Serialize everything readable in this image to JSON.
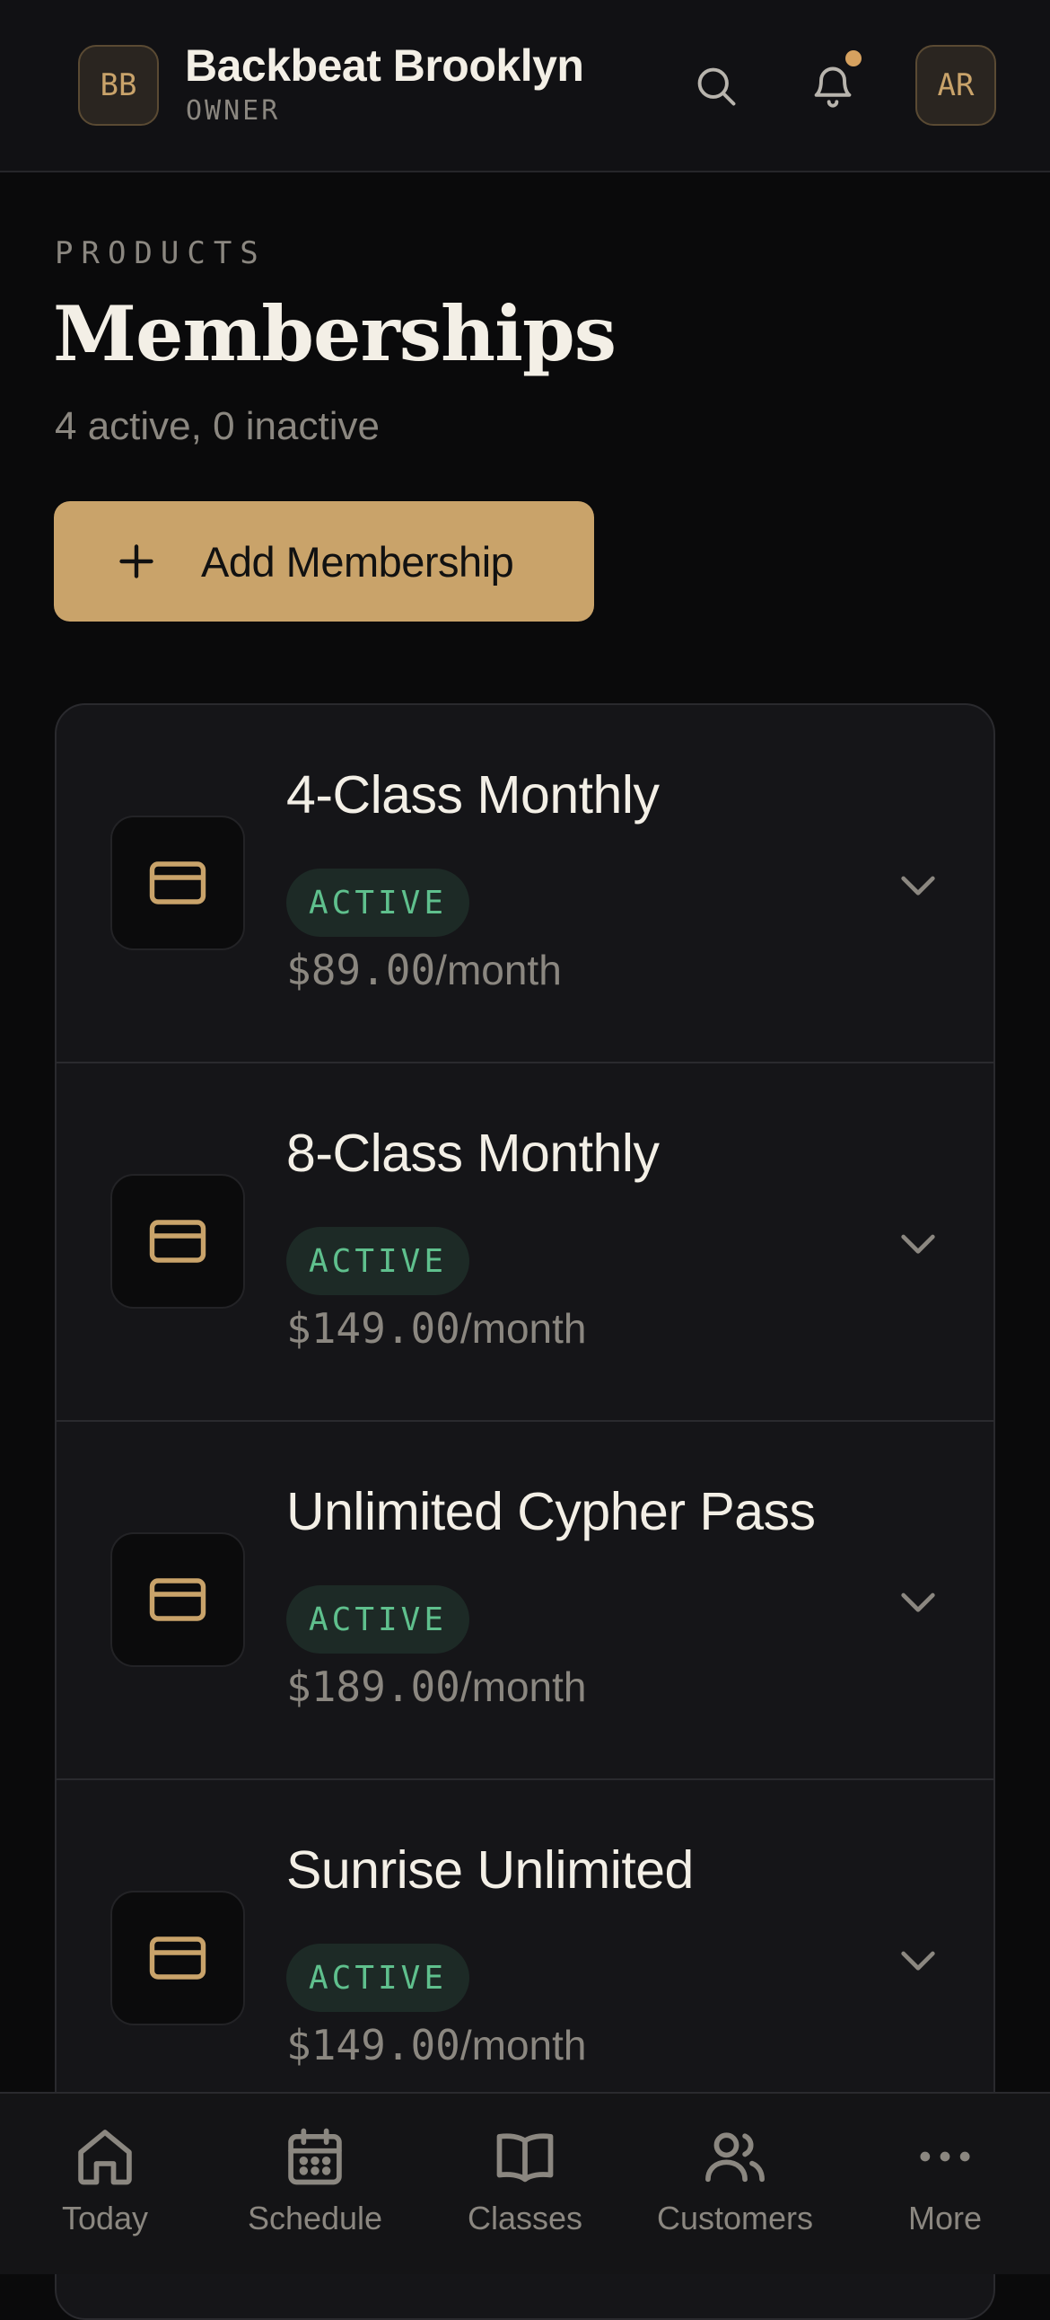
{
  "header": {
    "org_initials": "BB",
    "org_name": "Backbeat Brooklyn",
    "role": "OWNER",
    "user_initials": "AR",
    "icons": [
      "search-icon",
      "bell-icon"
    ],
    "has_notification": true
  },
  "page": {
    "eyebrow": "PRODUCTS",
    "title": "Memberships",
    "subtitle": "4 active, 0 inactive",
    "add_button_label": "Add Membership"
  },
  "memberships": [
    {
      "name": "4-Class Monthly",
      "status": "ACTIVE",
      "price": "$89.00",
      "period": "/month",
      "icon": "credit-card-icon"
    },
    {
      "name": "8-Class Monthly",
      "status": "ACTIVE",
      "price": "$149.00",
      "period": "/month",
      "icon": "credit-card-icon"
    },
    {
      "name": "Unlimited Cypher Pass",
      "status": "ACTIVE",
      "price": "$189.00",
      "period": "/month",
      "icon": "credit-card-icon"
    },
    {
      "name": "Sunrise Unlimited",
      "status": "ACTIVE",
      "price": "$149.00",
      "period": "/month",
      "icon": "credit-card-icon"
    }
  ],
  "nav": [
    {
      "label": "Today",
      "icon": "home-icon"
    },
    {
      "label": "Schedule",
      "icon": "calendar-icon"
    },
    {
      "label": "Classes",
      "icon": "book-icon"
    },
    {
      "label": "Customers",
      "icon": "users-icon"
    },
    {
      "label": "More",
      "icon": "more-dots-icon"
    }
  ],
  "colors": {
    "background": "#0a0a0b",
    "accent": "#c9a36a",
    "status_active_text": "#5fc08d",
    "status_active_bg": "#1d2a26",
    "muted_text": "#8b8780"
  }
}
